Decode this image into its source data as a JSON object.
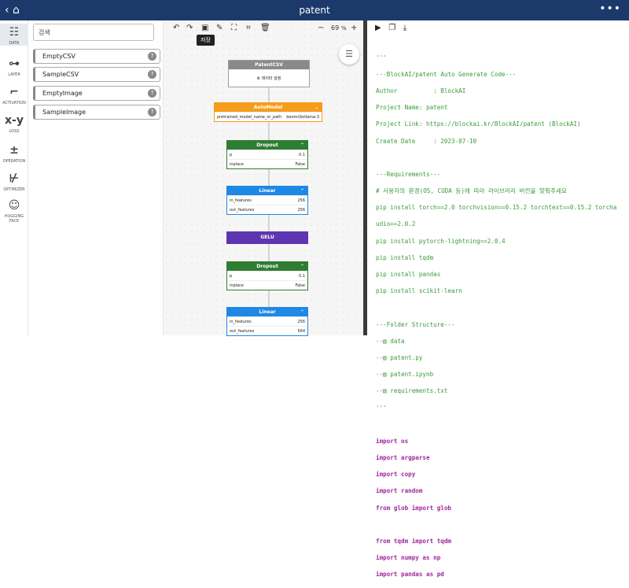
{
  "app": {
    "title": "patent"
  },
  "sidebar": {
    "items": [
      {
        "label": "DATA",
        "icon": "database-icon",
        "glyph": "☷"
      },
      {
        "label": "LAYER",
        "icon": "layer-icon",
        "glyph": "⊶"
      },
      {
        "label": "ACTIVATION",
        "icon": "activation-icon",
        "glyph": "⌐"
      },
      {
        "label": "LOSS",
        "icon": "loss-icon",
        "glyph": "x-y"
      },
      {
        "label": "OPERATION",
        "icon": "operation-icon",
        "glyph": "±"
      },
      {
        "label": "OPTIMIZER",
        "icon": "optimizer-icon",
        "glyph": "⊬"
      },
      {
        "label": "HUGGING FACE",
        "icon": "hugging-face-icon",
        "glyph": "☺"
      }
    ]
  },
  "palette": {
    "search_placeholder": "검색",
    "items": [
      "EmptyCSV",
      "SampleCSV",
      "EmptyImage",
      "SampleImage"
    ]
  },
  "canvas": {
    "zoom": "69",
    "zoom_unit": "%",
    "tooltip": "저장",
    "nodes": [
      {
        "title": "PatentCSV",
        "action": "데이터 설정"
      },
      {
        "title": "AutoModel",
        "param": "pretrained_model_name_or_path",
        "value": "beomi/kollama-3"
      },
      {
        "title": "Dropout",
        "rows": [
          {
            "k": "p",
            "v": "0.1"
          },
          {
            "k": "inplace",
            "v": "False"
          }
        ]
      },
      {
        "title": "Linear",
        "rows": [
          {
            "k": "in_features",
            "v": "256"
          },
          {
            "k": "out_features",
            "v": "256"
          }
        ]
      },
      {
        "title": "GELU"
      },
      {
        "title": "Dropout",
        "rows": [
          {
            "k": "p",
            "v": "0.1"
          },
          {
            "k": "inplace",
            "v": "False"
          }
        ]
      },
      {
        "title": "Linear",
        "rows": [
          {
            "k": "in_features",
            "v": "256"
          },
          {
            "k": "out_features",
            "v": "564"
          }
        ]
      }
    ]
  },
  "code": {
    "lines": [
      "'''",
      "---BlockAI/patent Auto Generate Code---",
      "Author          : BlockAI",
      "Project Name: patent",
      "Project Link: https://blockai.kr/BlockAI/patent (BlockAI)",
      "Create Date     : 2023-07-10",
      "",
      "---Requirements---",
      "# 사용자의 환경(OS, CUDA 등)에 따라 라이브러리 버전을 맞춰주세요",
      "pip install torch==2.0 torchvision==0.15.2 torchtext==0.15.2 torcha",
      "udio==2.0.2",
      "pip install pytorch-lightning==2.0.4",
      "pip install tqdm",
      "pip install pandas",
      "pip install scikit-learn",
      "",
      "---Folder Structure---",
      "--▤ data",
      "--▤ patent.py",
      "--▤ patent.ipynb",
      "--▤ requirements.txt",
      "'''",
      "",
      "import os",
      "import argparse",
      "import copy",
      "import random",
      "from glob import glob",
      "",
      "from tqdm import tqdm",
      "import numpy as np",
      "import pandas as pd"
    ]
  },
  "colors": {
    "header": "#1b3a6b",
    "dropout": "#2e7d32",
    "linear": "#1e88e5",
    "gelu": "#5e35b1",
    "automodel": "#f59c1a",
    "csv": "#8a8a8a"
  }
}
